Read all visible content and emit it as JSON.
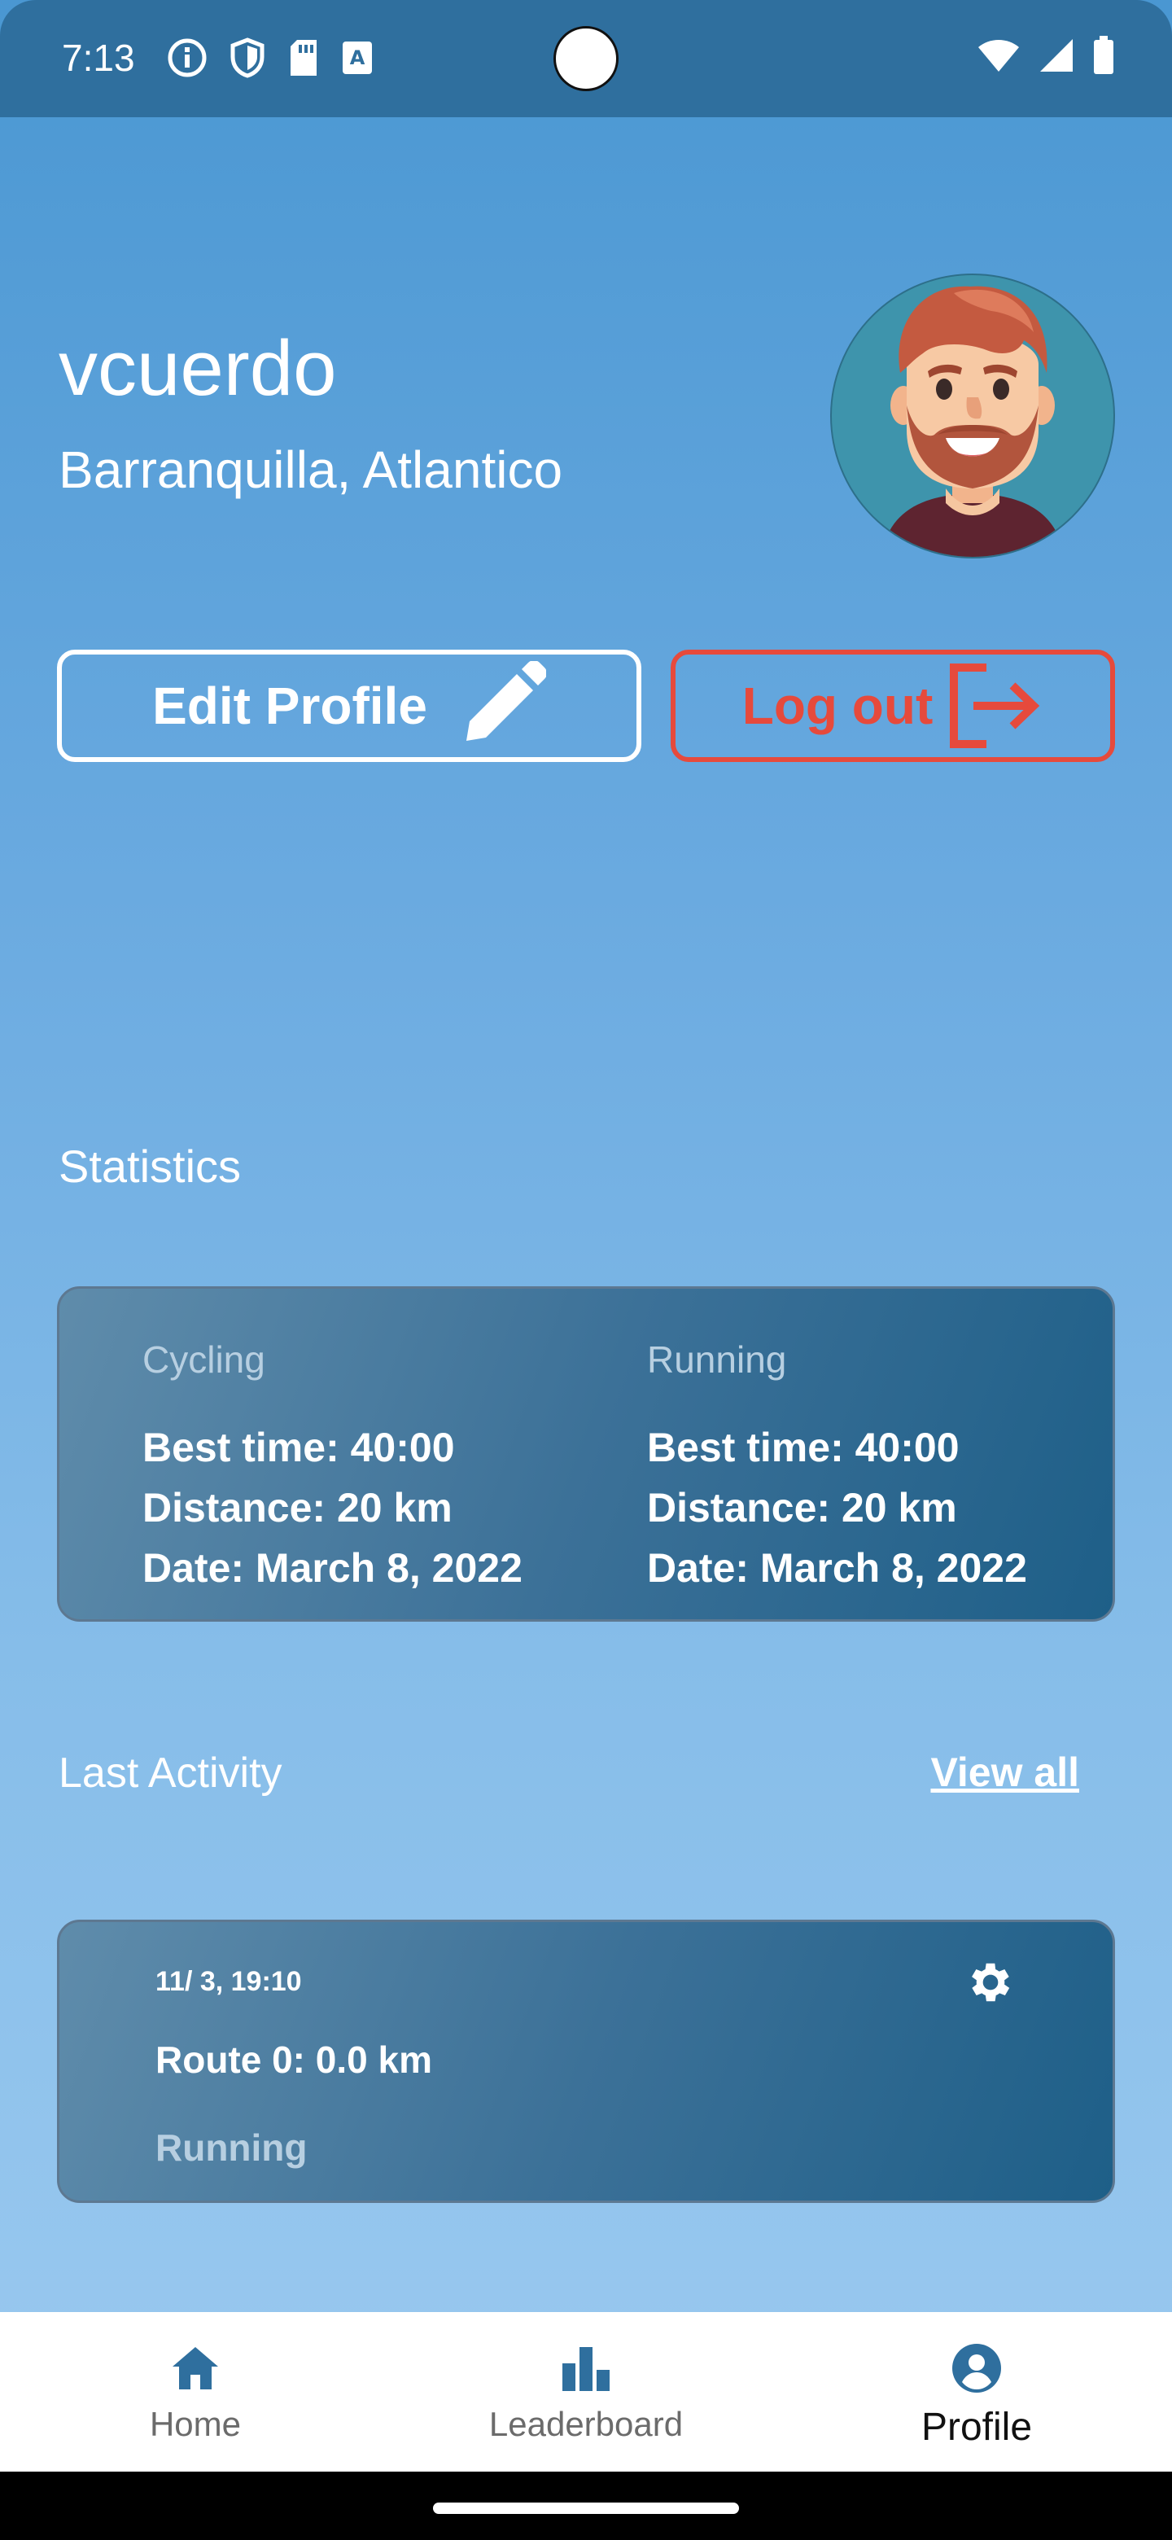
{
  "status_bar": {
    "time": "7:13"
  },
  "profile": {
    "username": "vcuerdo",
    "location": "Barranquilla, Atlantico",
    "avatar_icon": "cartoon-man-avatar"
  },
  "buttons": {
    "edit_profile": "Edit Profile",
    "log_out": "Log out"
  },
  "statistics": {
    "title": "Statistics",
    "cycling": {
      "label": "Cycling",
      "best_time": "Best time: 40:00",
      "distance": "Distance: 20 km",
      "date": "Date: March 8, 2022"
    },
    "running": {
      "label": "Running",
      "best_time": "Best time: 40:00",
      "distance": "Distance: 20 km",
      "date": "Date: March 8, 2022"
    }
  },
  "last_activity": {
    "title": "Last Activity",
    "view_all": "View all",
    "items": [
      {
        "date": "11/ 3, 19:10",
        "route": "Route 0: 0.0 km",
        "type": "Running"
      }
    ]
  },
  "bottom_nav": {
    "items": [
      {
        "label": "Home",
        "icon": "home-icon"
      },
      {
        "label": "Leaderboard",
        "icon": "leaderboard-icon"
      },
      {
        "label": "Profile",
        "icon": "account-circle-icon"
      }
    ],
    "active": "Profile"
  },
  "colors": {
    "accent_nav": "#2f6f9e",
    "logout_red": "#e64a3c",
    "status_bar": "#2f6f9e"
  }
}
